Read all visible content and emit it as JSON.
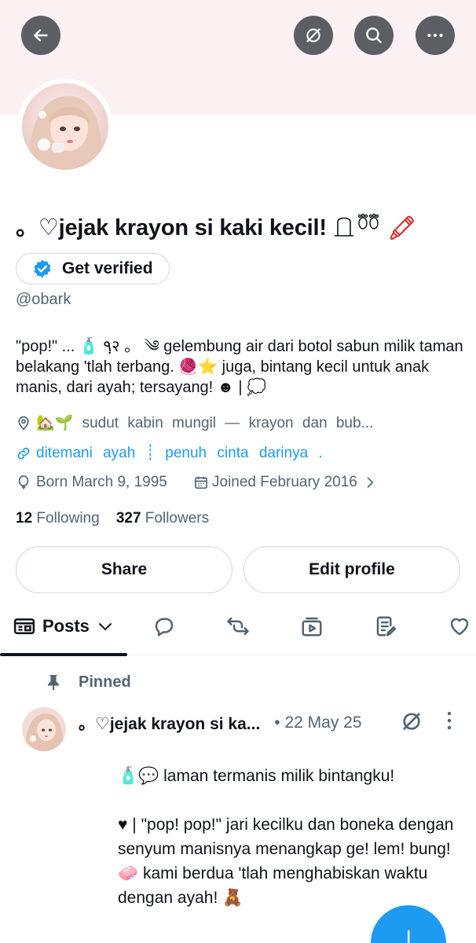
{
  "profile": {
    "display_name": "。♡jejak krayon si kaki kecil!",
    "name_emoji_tail": "🖍",
    "handle": "@obark",
    "verify_label": "Get verified",
    "bio": "\"pop!\" ... 🧴 ٩ฺ२ 。 ༄ gelembung air dari botol sabun milik taman belakang 'tlah terbang. 🧶⭐ juga, bintang kecil untuk anak manis, dari ayah; tersayang! ☻ | 💭",
    "location": "🏡🌱 sudut kabin mungil — krayon dan bub...",
    "link": "ditemani ayah ┊ penuh cinta darinya .",
    "born": "Born March 9, 1995",
    "joined": "Joined February 2016",
    "following_count": "12",
    "following_label": "Following",
    "followers_count": "327",
    "followers_label": "Followers"
  },
  "buttons": {
    "share": "Share",
    "edit_profile": "Edit profile"
  },
  "tabs": {
    "posts_label": "Posts"
  },
  "pinned_post": {
    "pinned_label": "Pinned",
    "author": "。♡jejak krayon si ka...",
    "date": "• 22 May 25",
    "line1": "🧴💬 laman termanis milik bintangku!",
    "line2": "♥ | \"pop! pop!\" jari kecilku dan boneka dengan senyum manisnya menangkap ge! lem! bung! 🧼  kami berdua 'tlah menghabiskan waktu dengan ayah! 🧸"
  },
  "icons": {
    "back": "arrow-left-icon",
    "grok": "grok-icon",
    "search": "search-icon",
    "more": "more-horizontal-icon",
    "verified": "verified-badge-icon",
    "location": "location-pin-icon",
    "link": "link-icon",
    "born": "balloon-icon",
    "joined": "calendar-icon",
    "posts": "posts-feed-icon",
    "replies": "reply-bubble-icon",
    "reposts": "repost-icon",
    "media": "media-icon",
    "articles": "articles-icon",
    "likes": "heart-icon",
    "pin": "pin-icon",
    "compose": "plus-icon"
  },
  "colors": {
    "accent": "#1d9bf0",
    "banner": "#fbf1f3",
    "muted": "#536471",
    "ink": "#0f1419"
  }
}
